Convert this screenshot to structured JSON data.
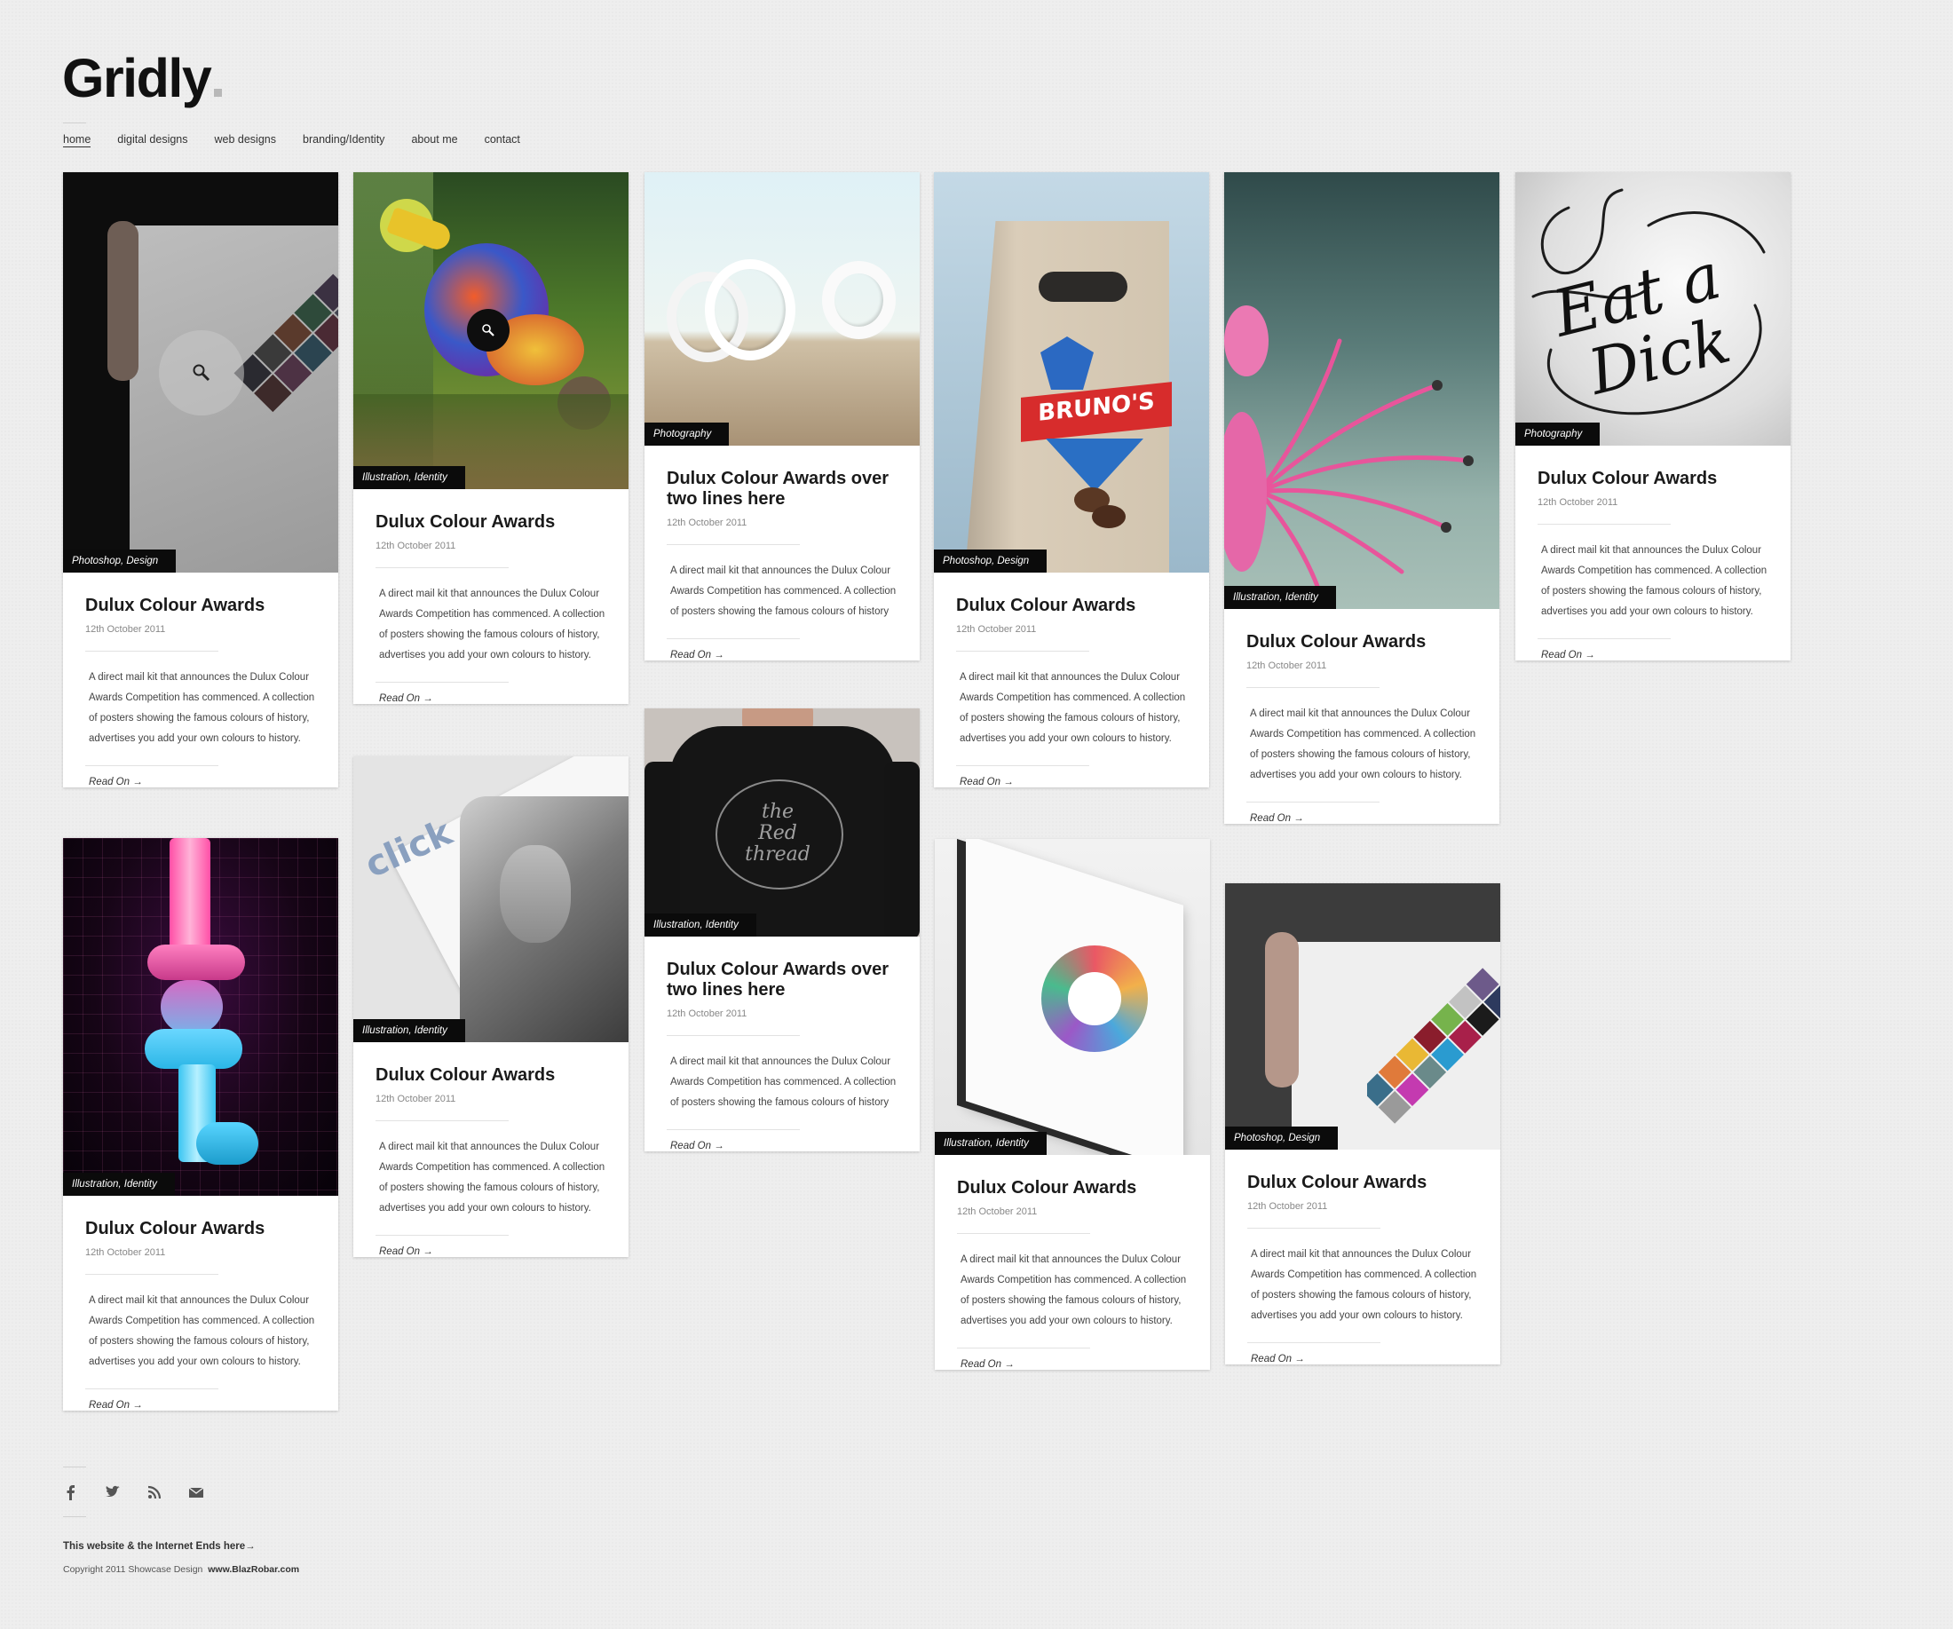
{
  "site": {
    "logo": "Gridly"
  },
  "nav": {
    "home": "home",
    "digital": "digital designs",
    "web": "web designs",
    "branding": "branding/Identity",
    "about": "about me",
    "contact": "contact"
  },
  "posts": [
    {
      "tag": "Photoshop, Design",
      "title": "Dulux Colour Awards",
      "date": "12th October 2011",
      "desc": "A direct mail kit that announces the Dulux Colour Awards Competition has commenced. A collection of posters showing the famous colours of history, advertises you add your own colours to history.",
      "read": "Read On →"
    },
    {
      "tag": "Illustration, Identity",
      "title": "Dulux Colour Awards",
      "date": "12th October 2011",
      "desc": "A direct mail kit that announces the Dulux Colour Awards Competition has commenced. A collection of posters showing the famous colours of history, advertises you add your own colours to history.",
      "read": "Read On →"
    },
    {
      "tag": "Illustration, Identity",
      "title": "Dulux Colour Awards",
      "date": "12th October 2011",
      "desc": "A direct mail kit that announces the Dulux Colour Awards Competition has commenced. A collection of posters showing the famous colours of history, advertises you add your own colours to history.",
      "read": "Read On →"
    },
    {
      "tag": "Illustration, Identity",
      "title": "Dulux Colour Awards",
      "date": "12th October 2011",
      "desc": "A direct mail kit that announces the Dulux Colour Awards Competition has commenced. A collection of posters showing the famous colours of history, advertises you add your own colours to history.",
      "read": "Read On →"
    },
    {
      "tag": "Photography",
      "title": "Dulux Colour Awards over two lines here",
      "date": "12th October 2011",
      "desc": "A direct mail kit that announces the Dulux Colour Awards Competition has commenced. A collection of posters showing the famous colours of history",
      "read": "Read On →"
    },
    {
      "tag": "Illustration, Identity",
      "title": "Dulux Colour Awards over two lines here",
      "date": "12th October 2011",
      "desc": "A direct mail kit that announces the Dulux Colour Awards Competition has commenced. A collection of posters showing the famous colours of history",
      "read": "Read On →"
    },
    {
      "tag": "Photoshop, Design",
      "title": "Dulux Colour Awards",
      "date": "12th October 2011",
      "desc": "A direct mail kit that announces the Dulux Colour Awards Competition has commenced. A collection of posters showing the famous colours of history, advertises you add your own colours to history.",
      "read": "Read On →"
    },
    {
      "tag": "Illustration, Identity",
      "title": "Dulux Colour Awards",
      "date": "12th October 2011",
      "desc": "A direct mail kit that announces the Dulux Colour Awards Competition has commenced. A collection of posters showing the famous colours of history, advertises you add your own colours to history.",
      "read": "Read On →"
    },
    {
      "tag": "Illustration, Identity",
      "title": "Dulux Colour Awards",
      "date": "12th October 2011",
      "desc": "A direct mail kit that announces the Dulux Colour Awards Competition has commenced. A collection of posters showing the famous colours of history, advertises you add your own colours to history.",
      "read": "Read On →"
    },
    {
      "tag": "Photoshop, Design",
      "title": "Dulux Colour Awards",
      "date": "12th October 2011",
      "desc": "A direct mail kit that announces the Dulux Colour Awards Competition has commenced. A collection of posters showing the famous colours of history, advertises you add your own colours to history.",
      "read": "Read On →"
    },
    {
      "tag": "Photography",
      "title": "Dulux Colour Awards",
      "date": "12th October 2011",
      "desc": "A direct mail kit that announces the Dulux Colour Awards Competition has commenced. A collection of posters showing the famous colours of history, advertises you add your own colours to history.",
      "read": "Read On →"
    }
  ],
  "footer": {
    "icons": [
      "facebook-icon",
      "twitter-icon",
      "rss-icon",
      "mail-icon"
    ],
    "line1": "This website & the  Internet Ends here→",
    "copyright": "Copyright 2011 Showcase Design",
    "site": "www.BlazRobar.com"
  }
}
